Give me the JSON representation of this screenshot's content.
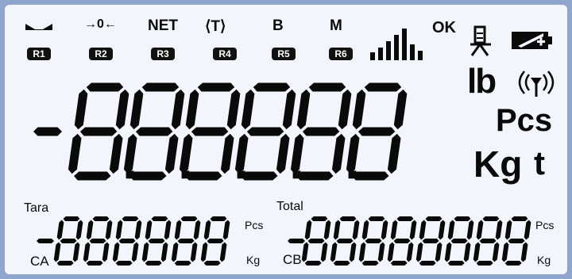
{
  "indicators": [
    {
      "symbol": "",
      "label": "R1",
      "icon": "stable-marker-icon"
    },
    {
      "symbol": "→0←",
      "label": "R2",
      "icon": "zero-indicator-icon"
    },
    {
      "symbol": "NET",
      "label": "R3",
      "icon": "net-indicator"
    },
    {
      "symbol": "⟨T⟩",
      "label": "R4",
      "icon": "tare-indicator"
    },
    {
      "symbol": "B",
      "label": "R5",
      "icon": "gross-indicator"
    },
    {
      "symbol": "M",
      "label": "R6",
      "icon": "memory-indicator"
    }
  ],
  "status": {
    "ok_label": "OK",
    "signal_icon": "signal-bars-icon",
    "scale_icon": "scale-icon",
    "battery_icon": "battery-charging-icon",
    "wireless_icon": "wireless-icon"
  },
  "main_display": {
    "value": "-8.8.8.8.8.8",
    "digit_count": 6
  },
  "units_main": {
    "lb": "lb",
    "pcs": "Pcs",
    "kg": "Kg",
    "t": "t"
  },
  "tare_display": {
    "label": "Tara",
    "prefix_label": "CA",
    "digit_count": 6,
    "value": "-888888",
    "unit_top": "Pcs",
    "unit_bottom": "Kg"
  },
  "total_display": {
    "label": "Total",
    "prefix_label": "CB",
    "digit_count": 8,
    "value": "-88888888",
    "unit_top": "Pcs",
    "unit_bottom": "Kg"
  },
  "colors": {
    "lcd_background": "#f2f5fb",
    "segment": "#0a0a0a",
    "bezel": "#8fa6cc"
  }
}
